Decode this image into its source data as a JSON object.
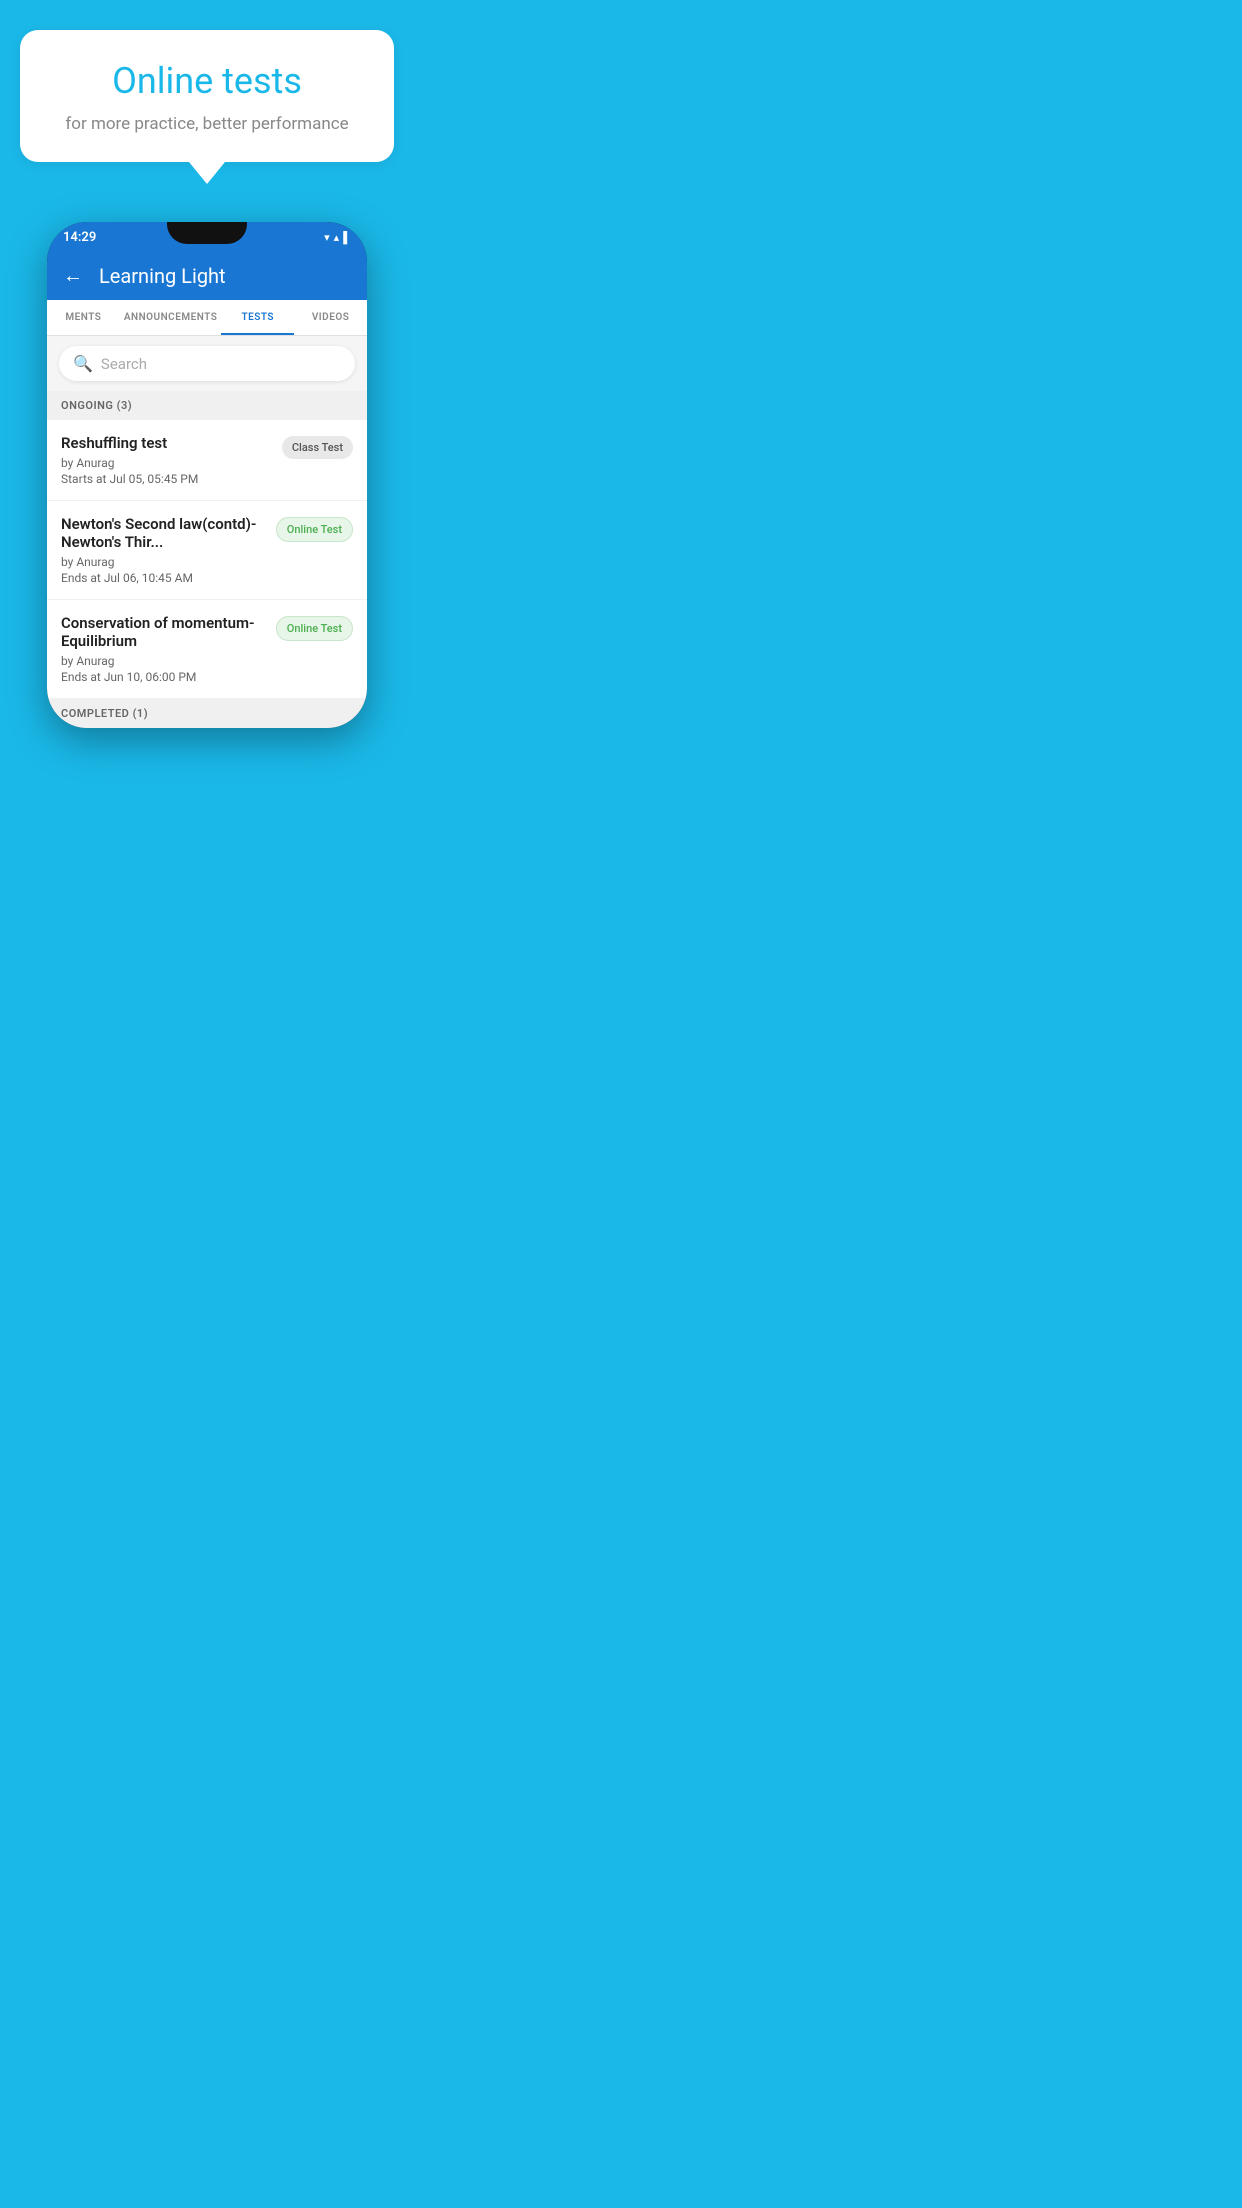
{
  "background_color": "#1ab8e8",
  "bubble": {
    "title": "Online tests",
    "subtitle": "for more practice, better performance"
  },
  "status_bar": {
    "time": "14:29",
    "icons": "▾ ▴ ▌"
  },
  "app_bar": {
    "title": "Learning Light",
    "back_label": "←"
  },
  "tabs": [
    {
      "label": "MENTS",
      "active": false
    },
    {
      "label": "ANNOUNCEMENTS",
      "active": false
    },
    {
      "label": "TESTS",
      "active": true
    },
    {
      "label": "VIDEOS",
      "active": false
    }
  ],
  "search": {
    "placeholder": "Search"
  },
  "sections": [
    {
      "header": "ONGOING (3)",
      "tests": [
        {
          "name": "Reshuffling test",
          "by": "by Anurag",
          "date": "Starts at  Jul 05, 05:45 PM",
          "badge": "Class Test",
          "badge_type": "class"
        },
        {
          "name": "Newton's Second law(contd)-Newton's Thir...",
          "by": "by Anurag",
          "date": "Ends at  Jul 06, 10:45 AM",
          "badge": "Online Test",
          "badge_type": "online"
        },
        {
          "name": "Conservation of momentum-Equilibrium",
          "by": "by Anurag",
          "date": "Ends at  Jun 10, 06:00 PM",
          "badge": "Online Test",
          "badge_type": "online"
        }
      ]
    }
  ],
  "completed_header": "COMPLETED (1)"
}
